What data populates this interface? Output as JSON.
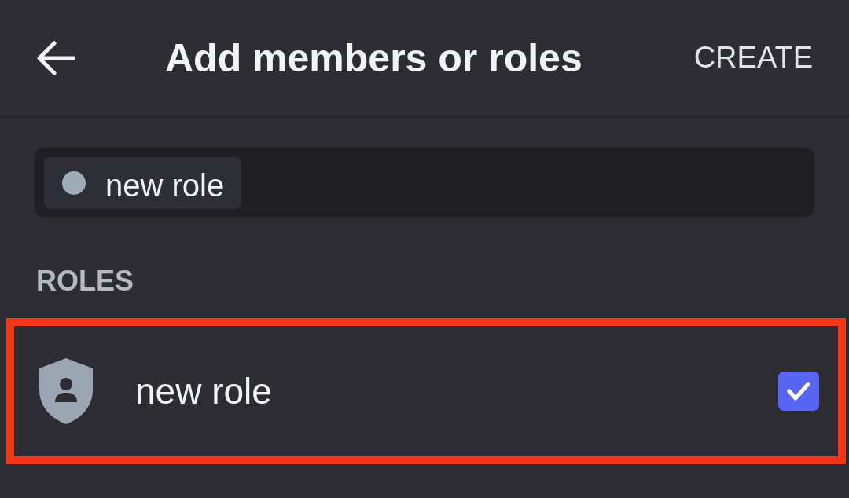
{
  "header": {
    "title": "Add members or roles",
    "action": "CREATE"
  },
  "search": {
    "chips": [
      {
        "label": "new role",
        "color": "#9fadb8"
      }
    ]
  },
  "sections": [
    {
      "heading": "ROLES",
      "items": [
        {
          "name": "new role",
          "checked": true,
          "highlighted": true
        }
      ]
    }
  ]
}
